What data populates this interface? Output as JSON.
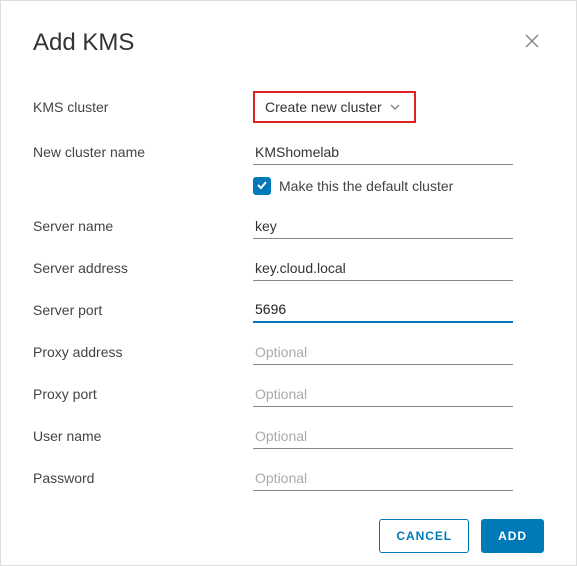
{
  "dialog": {
    "title": "Add KMS"
  },
  "fields": {
    "kms_cluster": {
      "label": "KMS cluster",
      "dropdown_value": "Create new cluster"
    },
    "new_cluster_name": {
      "label": "New cluster name",
      "value": "KMShomelab"
    },
    "default_checkbox": {
      "label": "Make this the default cluster",
      "checked": true
    },
    "server_name": {
      "label": "Server name",
      "value": "key"
    },
    "server_address": {
      "label": "Server address",
      "value": "key.cloud.local"
    },
    "server_port": {
      "label": "Server port",
      "value": "5696"
    },
    "proxy_address": {
      "label": "Proxy address",
      "placeholder": "Optional",
      "value": ""
    },
    "proxy_port": {
      "label": "Proxy port",
      "placeholder": "Optional",
      "value": ""
    },
    "user_name": {
      "label": "User name",
      "placeholder": "Optional",
      "value": ""
    },
    "password": {
      "label": "Password",
      "placeholder": "Optional",
      "value": ""
    }
  },
  "buttons": {
    "cancel": "CANCEL",
    "add": "ADD"
  }
}
